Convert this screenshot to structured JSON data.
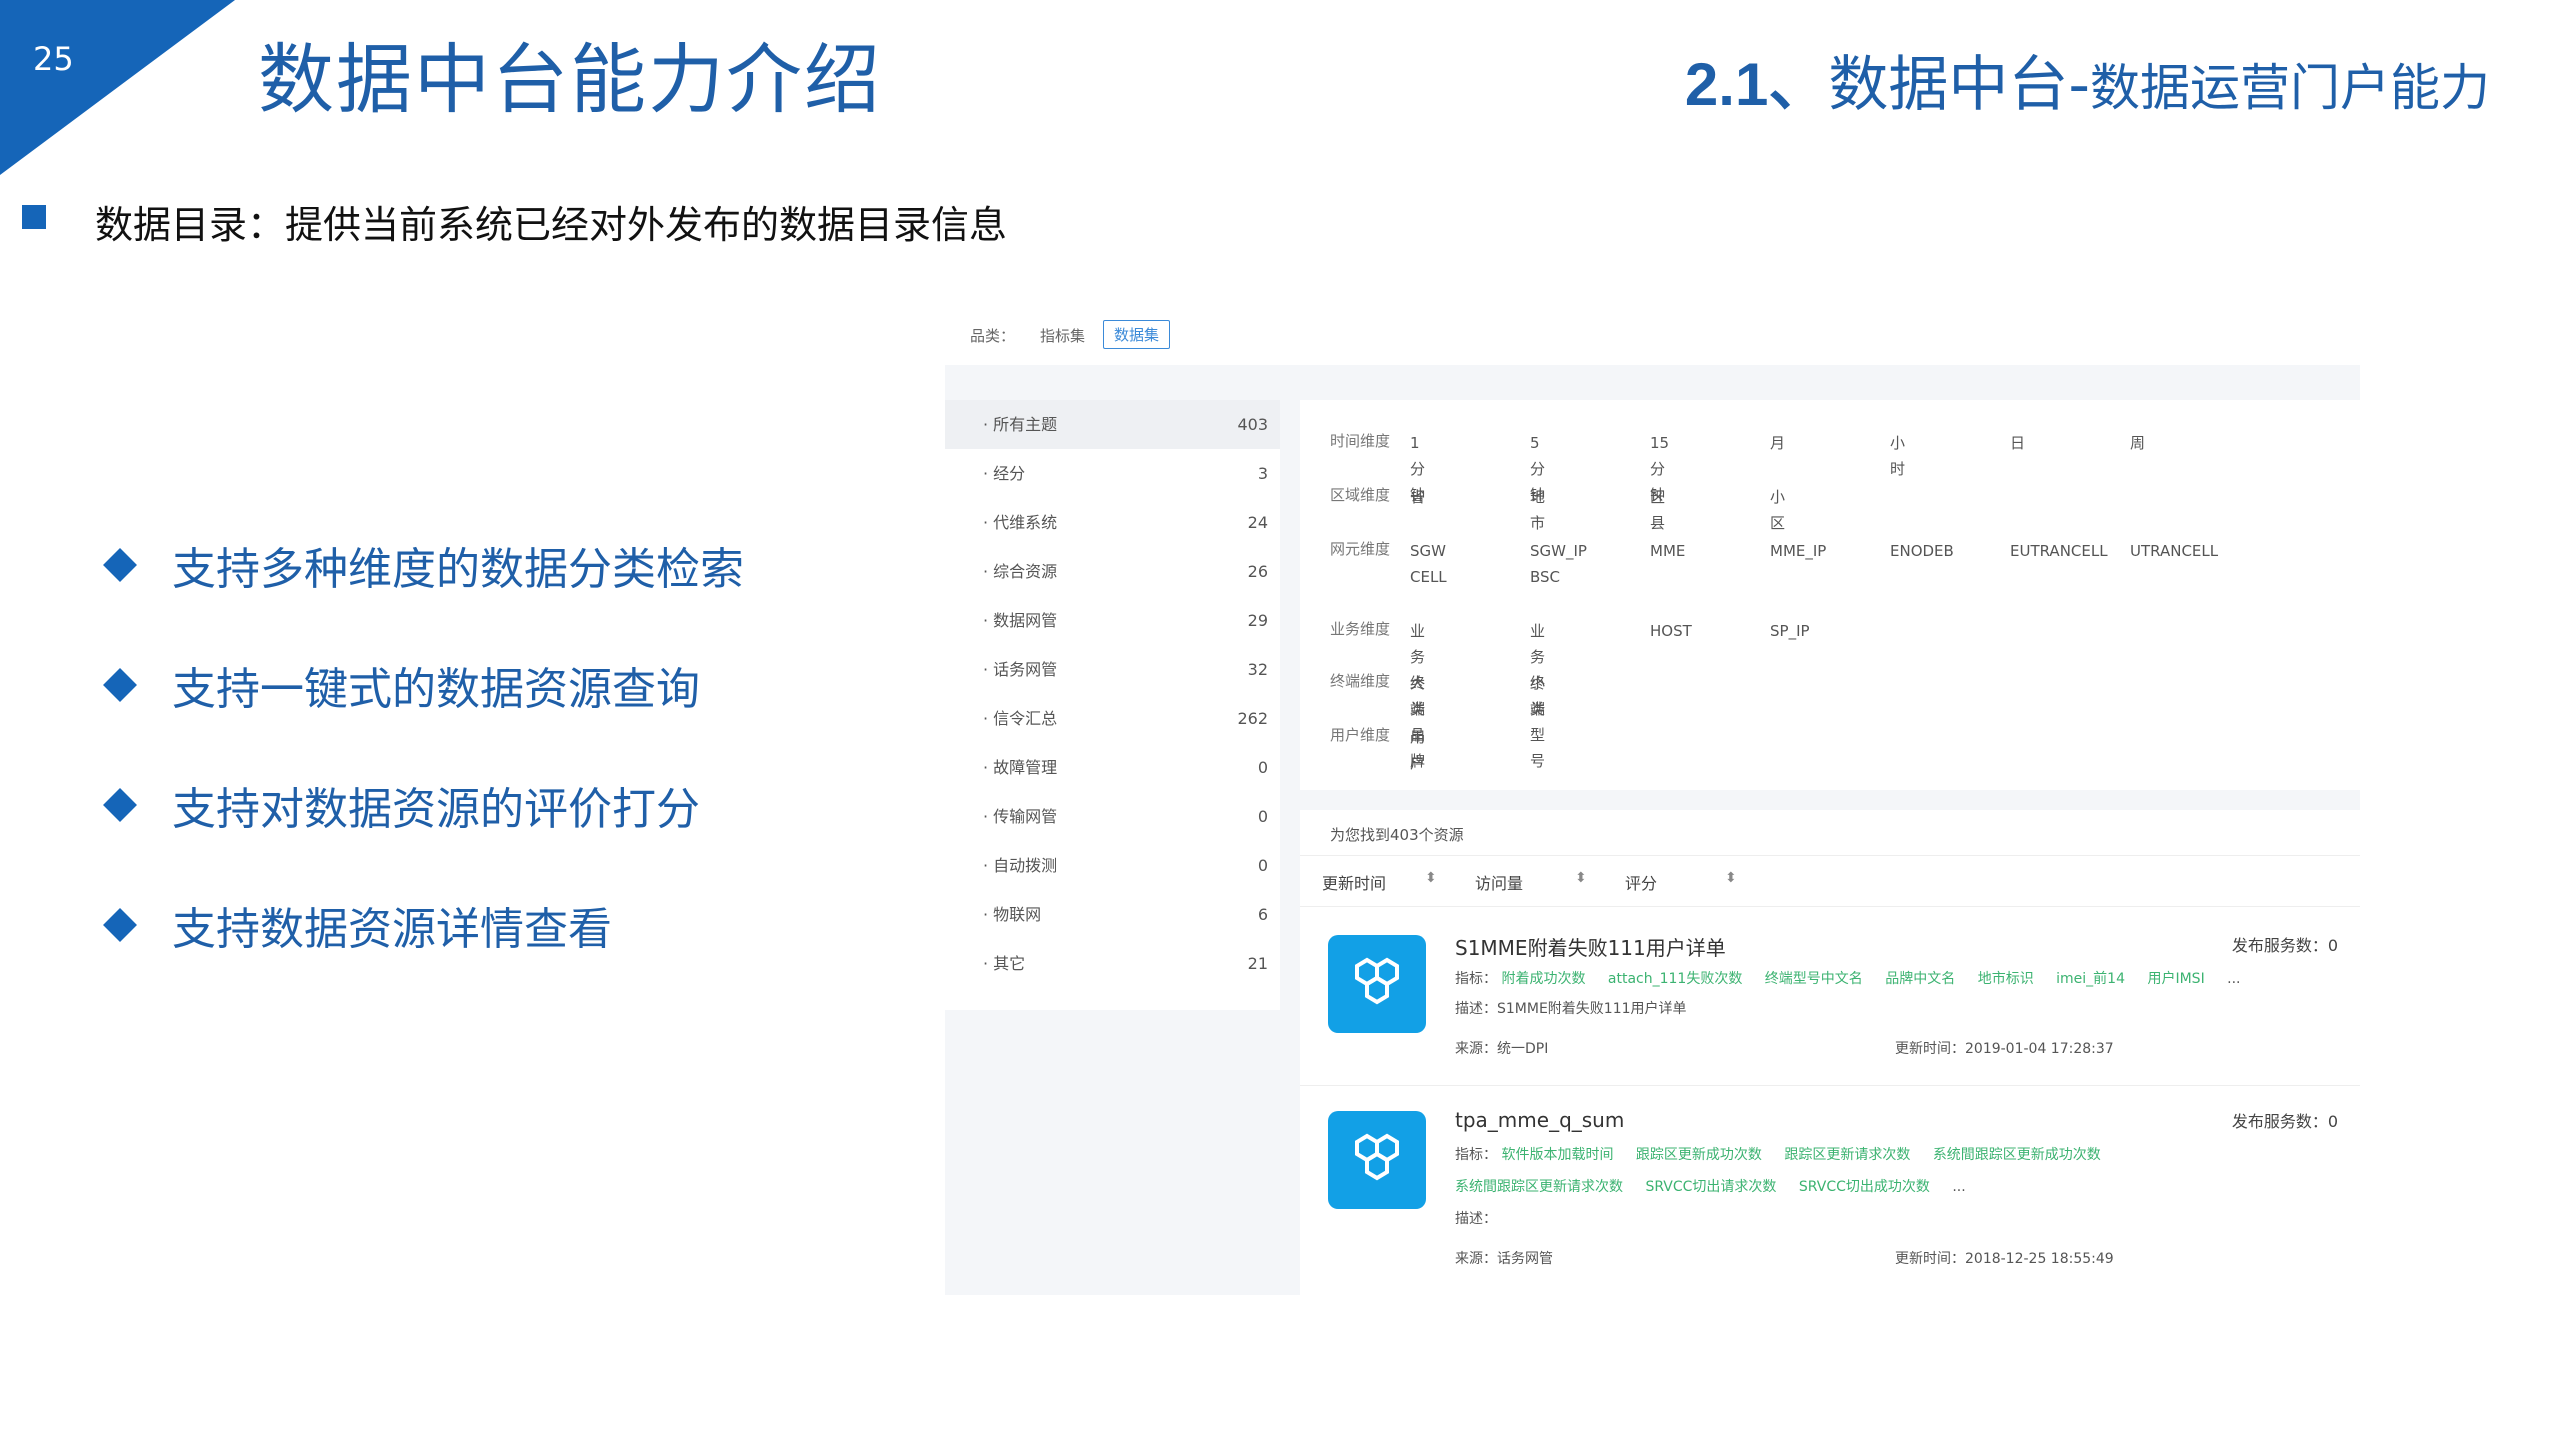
{
  "slide": {
    "page_number": "25",
    "title": "数据中台能力介绍",
    "subtitle_num": "2.1、",
    "subtitle_main": "数据中台-",
    "subtitle_small": "数据运营门户能力",
    "intro": "数据目录：提供当前系统已经对外发布的数据目录信息",
    "bullets": [
      "支持多种维度的数据分类检索",
      "支持一键式的数据资源查询",
      "支持对数据资源的评价打分",
      "支持数据资源详情查看"
    ],
    "accent_color": "#1565b8"
  },
  "portal": {
    "category_label": "品类：",
    "category_options": [
      "指标集",
      "数据集"
    ],
    "active_category": "数据集",
    "sidebar": [
      {
        "label": "· 所有主题",
        "count": "403"
      },
      {
        "label": "· 经分",
        "count": "3"
      },
      {
        "label": "· 代维系统",
        "count": "24"
      },
      {
        "label": "· 综合资源",
        "count": "26"
      },
      {
        "label": "· 数据网管",
        "count": "29"
      },
      {
        "label": "· 话务网管",
        "count": "32"
      },
      {
        "label": "· 信令汇总",
        "count": "262"
      },
      {
        "label": "· 故障管理",
        "count": "0"
      },
      {
        "label": "· 传输网管",
        "count": "0"
      },
      {
        "label": "· 自动拨测",
        "count": "0"
      },
      {
        "label": "· 物联网",
        "count": "6"
      },
      {
        "label": "· 其它",
        "count": "21"
      }
    ],
    "dimensions": [
      {
        "label": "时间维度",
        "values": [
          "1分钟",
          "5分钟",
          "15分钟",
          "月",
          "小时",
          "日",
          "周"
        ]
      },
      {
        "label": "区域维度",
        "values": [
          "省",
          "地市",
          "区县",
          "小区"
        ]
      },
      {
        "label": "网元维度",
        "values": [
          "SGW\nCELL",
          "SGW_IP\nBSC",
          "MME",
          "MME_IP",
          "ENODEB",
          "EUTRANCELL",
          "UTRANCELL"
        ]
      },
      {
        "label": "业务维度",
        "values": [
          "业务大类",
          "业务小类",
          "HOST",
          "SP_IP"
        ]
      },
      {
        "label": "终端维度",
        "values": [
          "终端品牌",
          "终端型号"
        ]
      },
      {
        "label": "用户维度",
        "values": [
          "用户"
        ]
      }
    ],
    "found_text": "为您找到403个资源",
    "sort": {
      "time": "更新时间",
      "visits": "访问量",
      "rating": "评分",
      "time_icon": "⬍",
      "visits_icon": "⬍",
      "rating_icon": "⬍"
    },
    "results": [
      {
        "title": "S1MME附着失败111用户详单",
        "published": "发布服务数：0",
        "indicators_label": "指标：",
        "tags": [
          "附着成功次数",
          "attach_111失败次数",
          "终端型号中文名",
          "品牌中文名",
          "地市标识",
          "imei_前14",
          "用户IMSI",
          "..."
        ],
        "tags2": [],
        "description": "描述：S1MME附着失败111用户详单",
        "source": "来源：统一DPI",
        "updated": "更新时间：2019-01-04 17:28:37"
      },
      {
        "title": "tpa_mme_q_sum",
        "published": "发布服务数：0",
        "indicators_label": "指标：",
        "tags": [
          "软件版本加载时间",
          "跟踪区更新成功次数",
          "跟踪区更新请求次数",
          "系统間跟踪区更新成功次数"
        ],
        "tags2": [
          "系统間跟踪区更新请求次数",
          "SRVCC切出请求次数",
          "SRVCC切出成功次数",
          "..."
        ],
        "description": "描述：",
        "source": "来源：话务网管",
        "updated": "更新时间：2018-12-25 18:55:49"
      }
    ],
    "icon_color": "#12a0e6",
    "tag_color": "#3cb371"
  }
}
